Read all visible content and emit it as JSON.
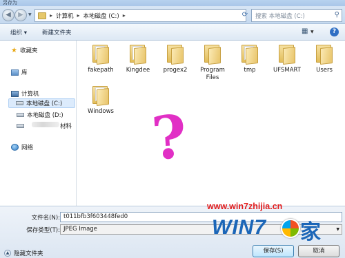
{
  "window": {
    "title": "另存为"
  },
  "address_bar": {
    "crumbs": [
      "计算机",
      "本地磁盘 (C:)"
    ],
    "search_placeholder": "搜索 本地磁盘 (C:)"
  },
  "toolbar": {
    "organize": "组织 ▾",
    "new_folder": "新建文件夹"
  },
  "nav": {
    "favorites": "收藏夹",
    "libraries": "库",
    "computer": "计算机",
    "drive_c": "本地磁盘 (C:)",
    "drive_d": "本地磁盘 (D:)",
    "other_fragment": "材料",
    "network": "网络"
  },
  "folders": [
    {
      "label": "fakepath"
    },
    {
      "label": "Kingdee"
    },
    {
      "label": "progex2"
    },
    {
      "label": "Program Files"
    },
    {
      "label": "tmp"
    },
    {
      "label": "UFSMART"
    },
    {
      "label": "Users"
    },
    {
      "label": "Windows"
    }
  ],
  "annotation": {
    "mark": "?",
    "color": "#e12fc5"
  },
  "form": {
    "filename_label": "文件名(N):",
    "filename_value": "t011bfb3f603448fed0",
    "filetype_label": "保存类型(T):",
    "filetype_value": "JPEG Image",
    "hide_folders": "隐藏文件夹",
    "save": "保存(S)",
    "cancel": "取消"
  },
  "watermark": {
    "url": "www.win7zhijia.cn",
    "logo_text": "WIN7",
    "logo_suffix": "家"
  },
  "colors": {
    "watermark_red": "#e21c1c",
    "watermark_blue": "#1b66b8",
    "selection": "#dcebfc"
  }
}
